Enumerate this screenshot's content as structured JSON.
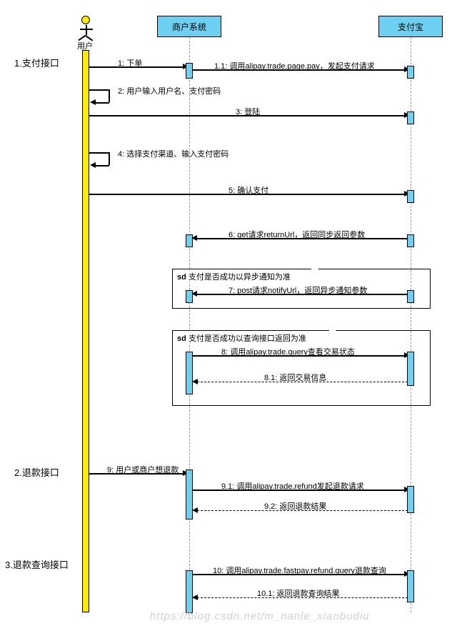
{
  "actors": {
    "user": "用户",
    "merchant": "商户系统",
    "alipay": "支付宝"
  },
  "sections": {
    "s1": "1.支付接口",
    "s2": "2.退款接口",
    "s3": "3.退款查询接口"
  },
  "fragments": {
    "f1_tag": "sd",
    "f1_title": "支付是否成功以异步通知为准",
    "f2_tag": "sd",
    "f2_title": "支付是否成功以查询接口返回为准"
  },
  "messages": {
    "m1": "1: 下单",
    "m1_1": "1.1: 调用alipay.trade.page.pay，发起支付请求",
    "m2": "2: 用户输入用户名、支付密码",
    "m3": "3: 登陆",
    "m4": "4: 选择支付渠道、输入支付密码",
    "m5": "5: 确认支付",
    "m6": "6: get请求returnUrl，返回同步返回参数",
    "m7": "7: post请求notifyUrl，返回异步通知参数",
    "m8": "8: 调用alipay.trade.query查看交易状态",
    "m8_1": "8.1: 返回交易信息",
    "m9": "9: 用户或商户想退款",
    "m9_1": "9.1: 调用alipay.trade.refund发起退款请求",
    "m9_2": "9.2: 返回退款结果",
    "m10": "10: 调用alipay.trade.fastpay.refund.query退款查询",
    "m10_1": "10.1: 返回退款查询结果"
  },
  "watermark": "https://blog.csdn.net/m_nanle_xiaobudiu",
  "chart_data": {
    "type": "sequence-diagram",
    "participants": [
      "用户",
      "商户系统",
      "支付宝"
    ],
    "sections": [
      {
        "label": "1.支付接口",
        "messages": [
          {
            "from": "用户",
            "to": "商户系统",
            "text": "1: 下单"
          },
          {
            "from": "商户系统",
            "to": "支付宝",
            "text": "1.1: 调用alipay.trade.page.pay，发起支付请求"
          },
          {
            "from": "用户",
            "to": "用户",
            "text": "2: 用户输入用户名、支付密码"
          },
          {
            "from": "用户",
            "to": "支付宝",
            "text": "3: 登陆"
          },
          {
            "from": "用户",
            "to": "用户",
            "text": "4: 选择支付渠道、输入支付密码"
          },
          {
            "from": "用户",
            "to": "支付宝",
            "text": "5: 确认支付"
          },
          {
            "from": "支付宝",
            "to": "商户系统",
            "text": "6: get请求returnUrl，返回同步返回参数"
          },
          {
            "fragment": "sd 支付是否成功以异步通知为准",
            "messages": [
              {
                "from": "支付宝",
                "to": "商户系统",
                "text": "7: post请求notifyUrl，返回异步通知参数"
              }
            ]
          },
          {
            "fragment": "sd 支付是否成功以查询接口返回为准",
            "messages": [
              {
                "from": "商户系统",
                "to": "支付宝",
                "text": "8: 调用alipay.trade.query查看交易状态"
              },
              {
                "from": "支付宝",
                "to": "商户系统",
                "text": "8.1: 返回交易信息",
                "dashed": true
              }
            ]
          }
        ]
      },
      {
        "label": "2.退款接口",
        "messages": [
          {
            "from": "用户",
            "to": "商户系统",
            "text": "9: 用户或商户想退款"
          },
          {
            "from": "商户系统",
            "to": "支付宝",
            "text": "9.1: 调用alipay.trade.refund发起退款请求"
          },
          {
            "from": "支付宝",
            "to": "商户系统",
            "text": "9.2: 返回退款结果",
            "dashed": true
          }
        ]
      },
      {
        "label": "3.退款查询接口",
        "messages": [
          {
            "from": "商户系统",
            "to": "支付宝",
            "text": "10: 调用alipay.trade.fastpay.refund.query退款查询"
          },
          {
            "from": "支付宝",
            "to": "商户系统",
            "text": "10.1: 返回退款查询结果",
            "dashed": true
          }
        ]
      }
    ]
  }
}
